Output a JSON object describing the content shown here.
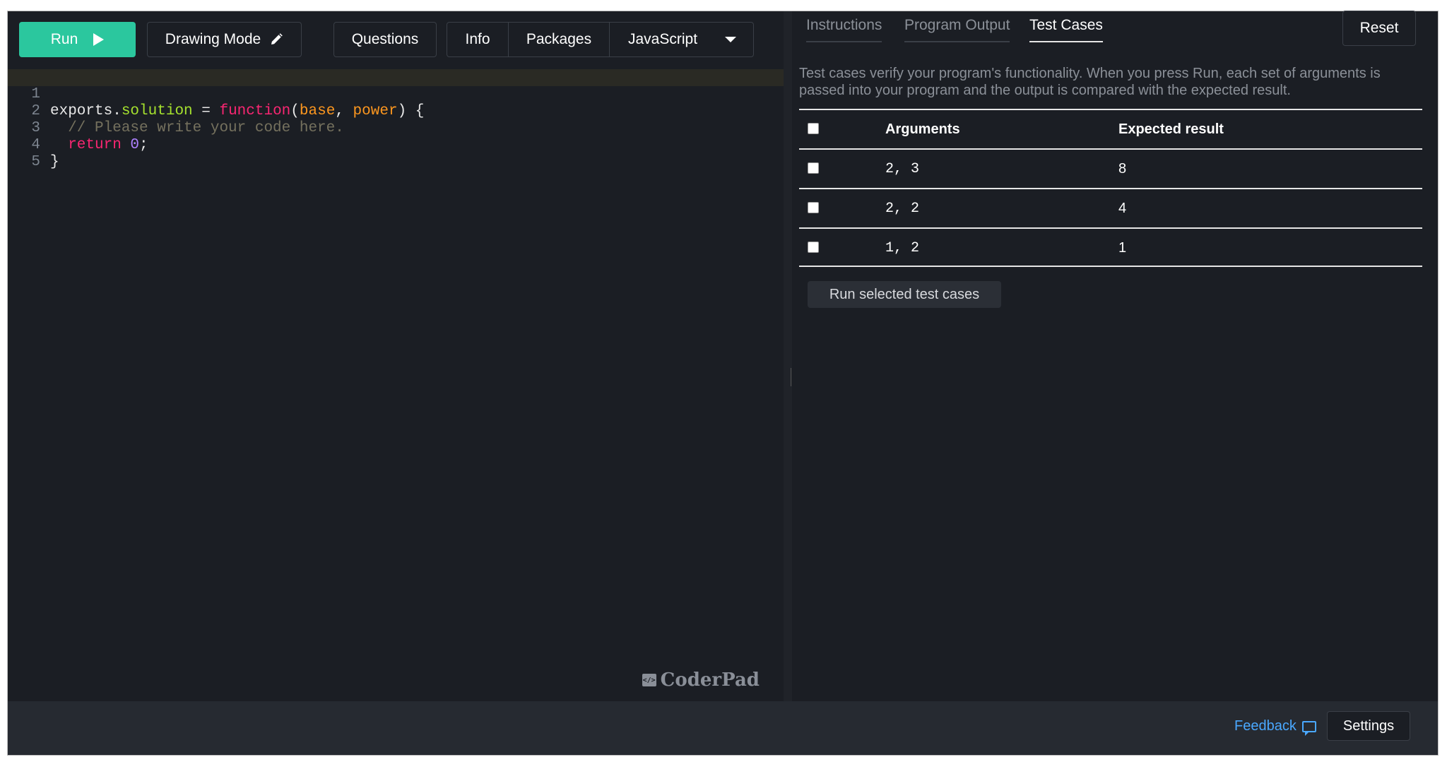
{
  "toolbar": {
    "run_label": "Run",
    "drawing_label": "Drawing Mode",
    "questions_label": "Questions",
    "info_label": "Info",
    "packages_label": "Packages",
    "language_label": "JavaScript"
  },
  "editor": {
    "line_numbers": [
      "1",
      "2",
      "3",
      "4",
      "5"
    ],
    "brand": "CoderPad"
  },
  "right": {
    "tabs": [
      "Instructions",
      "Program Output",
      "Test Cases"
    ],
    "reset_label": "Reset",
    "description": "Test cases verify your program's functionality. When you press Run, each set of arguments is passed into your program and the output is compared with the expected result.",
    "table": {
      "headers": [
        "Arguments",
        "Expected result"
      ],
      "rows": [
        {
          "args": "2, 3",
          "expected": "8"
        },
        {
          "args": "2, 2",
          "expected": "4"
        },
        {
          "args": "1, 2",
          "expected": "1"
        }
      ]
    },
    "run_selected_label": "Run selected test cases"
  },
  "footer": {
    "feedback_label": "Feedback",
    "settings_label": "Settings"
  },
  "colors": {
    "run_button": "#2bc79e",
    "background": "#1b1e24",
    "link": "#4aa8ff"
  }
}
